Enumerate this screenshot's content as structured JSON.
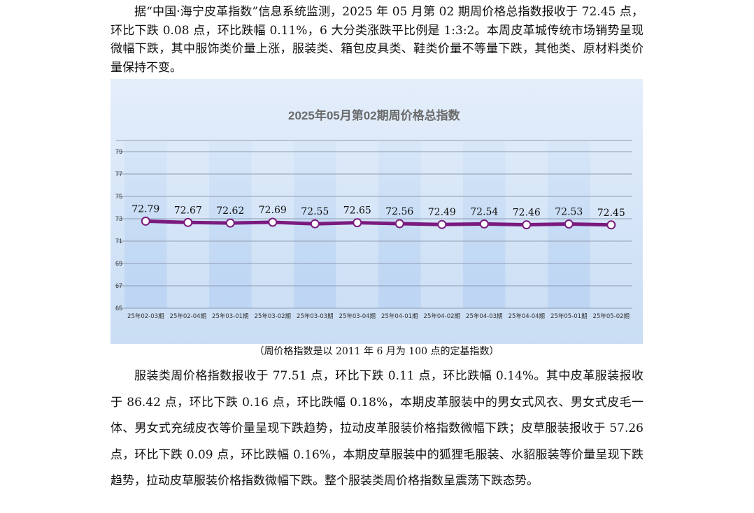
{
  "intro_paragraph": "据“中国·海宁皮革指数”信息系统监测，2025 年 05 月第 02 期周价格总指数报收于 72.45 点，环比下跌 0.08 点，环比跌幅 0.11%，6 大分类涨跌平比例是 1:3:2。本周皮革城传统市场销势呈现微幅下跌，其中服饰类价量上涨，服装类、箱包皮具类、鞋类价量不等量下跌，其他类、原材料类价量保持不变。",
  "chart_caption": "（周价格指数是以 2011 年 6 月为 100 点的定基指数）",
  "body_paragraph": "服装类周价格指数报收于 77.51 点，环比下跌 0.11 点，环比跌幅 0.14%。其中皮革服装报收于 86.42 点，环比下跌 0.16 点，环比跌幅 0.18%，本期皮革服装中的男女式风衣、男女式皮毛一体、男女式充绒皮衣等价量呈现下跌趋势，拉动皮革服装价格指数微幅下跌；皮草服装报收于 57.26 点，环比下跌 0.09 点，环比跌幅 0.16%，本期皮草服装中的狐狸毛服装、水貂服装等价量呈现下跌趋势，拉动皮草服装价格指数微幅下跌。整个服装类周价格指数呈震荡下跌态势。",
  "colors": {
    "line": "#7a1a7e",
    "marker_fill": "#ffffff",
    "band": "#bcd5f3",
    "background_top": "#e4eefb",
    "background_bottom": "#c9ddf4",
    "grid": "#8f9cb0",
    "title": "#6b6b6b"
  },
  "chart_data": {
    "type": "line",
    "title": "2025年05月第02期周价格总指数",
    "categories": [
      "25年02-03期",
      "25年02-04期",
      "25年03-01期",
      "25年03-02期",
      "25年03-03期",
      "25年03-04期",
      "25年04-01期",
      "25年04-02期",
      "25年04-03期",
      "25年04-04期",
      "25年05-01期",
      "25年05-02期"
    ],
    "values": [
      72.79,
      72.67,
      72.62,
      72.69,
      72.55,
      72.65,
      72.56,
      72.49,
      72.54,
      72.46,
      72.53,
      72.45
    ],
    "data_labels": [
      "72.79",
      "72.67",
      "72.62",
      "72.69",
      "72.55",
      "72.65",
      "72.56",
      "72.49",
      "72.54",
      "72.46",
      "72.53",
      "72.45"
    ],
    "yticks": [
      65,
      67,
      69,
      71,
      73,
      75,
      77,
      79
    ],
    "ylim": [
      65,
      80
    ],
    "grid": true,
    "legend": "none"
  }
}
